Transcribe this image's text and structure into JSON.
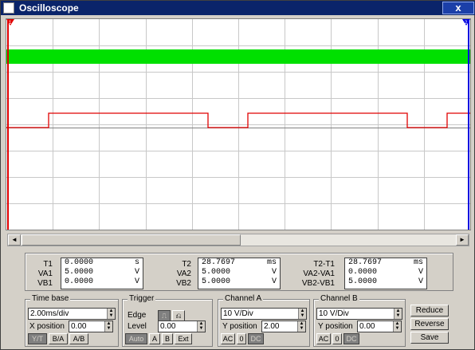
{
  "window": {
    "title": "Oscilloscope",
    "close_label": "x"
  },
  "screen": {
    "grid_columns": 10,
    "grid_rows": 8,
    "channel_a_color": "#00e000",
    "channel_b_color": "#e00000",
    "marker_t1": "1",
    "marker_t2": "2"
  },
  "readout": {
    "t1": {
      "label": "T1",
      "time": "0.0000",
      "time_unit": "s"
    },
    "va1": {
      "label": "VA1",
      "value": "5.0000",
      "unit": "V"
    },
    "vb1": {
      "label": "VB1",
      "value": "0.0000",
      "unit": "V"
    },
    "t2": {
      "label": "T2",
      "time": "28.7697",
      "time_unit": "ms"
    },
    "va2": {
      "label": "VA2",
      "value": "5.0000",
      "unit": "V"
    },
    "vb2": {
      "label": "VB2",
      "value": "5.0000",
      "unit": "V"
    },
    "t21": {
      "label": "T2-T1",
      "time": "28.7697",
      "time_unit": "ms"
    },
    "va21": {
      "label": "VA2-VA1",
      "value": "0.0000",
      "unit": "V"
    },
    "vb21": {
      "label": "VB2-VB1",
      "value": "5.0000",
      "unit": "V"
    }
  },
  "timebase": {
    "title": "Time base",
    "value": "2.00ms/div",
    "xpos_label": "X position",
    "xpos": "0.00",
    "modes": [
      "Y/T",
      "B/A",
      "A/B"
    ]
  },
  "trigger": {
    "title": "Trigger",
    "edge_label": "Edge",
    "level_label": "Level",
    "level": "0.00",
    "modes": [
      "Auto",
      "A",
      "B",
      "Ext"
    ]
  },
  "channel_a": {
    "title": "Channel A",
    "scale": "10 V/Div",
    "ypos_label": "Y position",
    "ypos": "2.00",
    "coupling": [
      "AC",
      "0",
      "DC"
    ]
  },
  "channel_b": {
    "title": "Channel B",
    "scale": "10 V/Div",
    "ypos_label": "Y position",
    "ypos": "0.00",
    "coupling": [
      "AC",
      "0",
      "DC"
    ]
  },
  "actions": {
    "reduce": "Reduce",
    "reverse": "Reverse",
    "save": "Save"
  }
}
